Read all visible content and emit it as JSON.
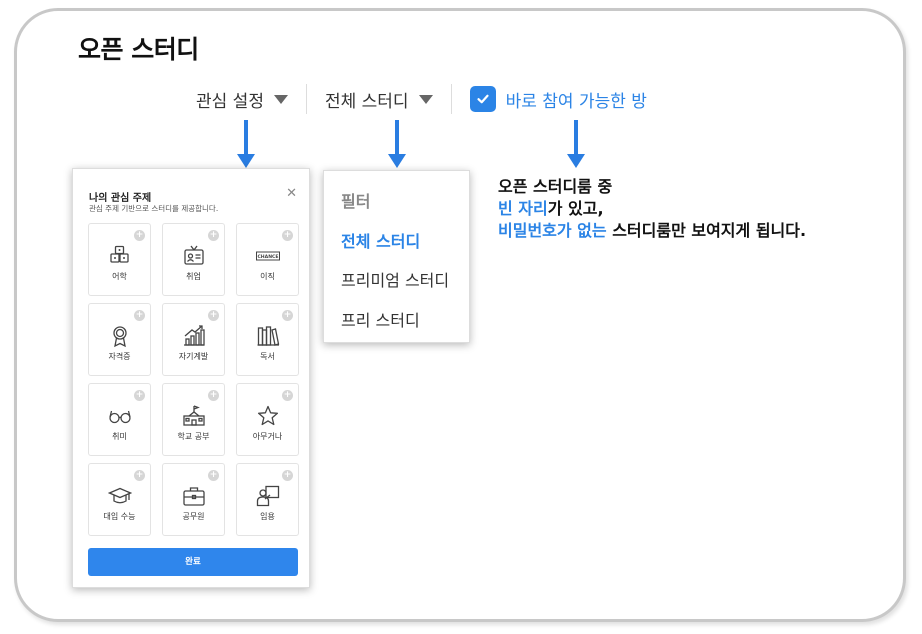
{
  "page": {
    "title": "오픈 스터디"
  },
  "filters": {
    "interest_label": "관심 설정",
    "study_type_label": "전체 스터디",
    "available_checkbox": {
      "label": "바로 참여 가능한 방",
      "checked": true
    }
  },
  "interest_panel": {
    "title": "나의 관심 주제",
    "subtitle": "관심 주제 기반으로 스터디를 제공합니다.",
    "tiles": [
      {
        "label": "어학",
        "icon": "dice-icon"
      },
      {
        "label": "취업",
        "icon": "id-badge-icon"
      },
      {
        "label": "이직",
        "icon": "chance-sign-icon",
        "icon_text": "CHANCE"
      },
      {
        "label": "자격증",
        "icon": "medal-icon"
      },
      {
        "label": "자기계발",
        "icon": "growth-chart-icon"
      },
      {
        "label": "독서",
        "icon": "books-icon"
      },
      {
        "label": "취미",
        "icon": "glasses-icon"
      },
      {
        "label": "학교 공부",
        "icon": "school-icon"
      },
      {
        "label": "아무거나",
        "icon": "star-icon"
      },
      {
        "label": "대입 수능",
        "icon": "graduation-cap-icon"
      },
      {
        "label": "공무원",
        "icon": "briefcase-icon"
      },
      {
        "label": "임용",
        "icon": "teacher-icon"
      }
    ],
    "done_label": "완료"
  },
  "study_dropdown": {
    "header": "필터",
    "items": [
      {
        "label": "전체 스터디",
        "selected": true
      },
      {
        "label": "프리미엄 스터디",
        "selected": false
      },
      {
        "label": "프리 스터디",
        "selected": false
      }
    ]
  },
  "note": {
    "line1": "오픈 스터디룸 중",
    "line2_highlight": "빈 자리",
    "line2_rest": "가 있고,",
    "line3_highlight": "비밀번호가 없는",
    "line3_rest": " 스터디룸만 보여지게 됩니다."
  },
  "colors": {
    "accent": "#2b84e6",
    "arrow": "#2a7de1",
    "button": "#2f86ec"
  }
}
